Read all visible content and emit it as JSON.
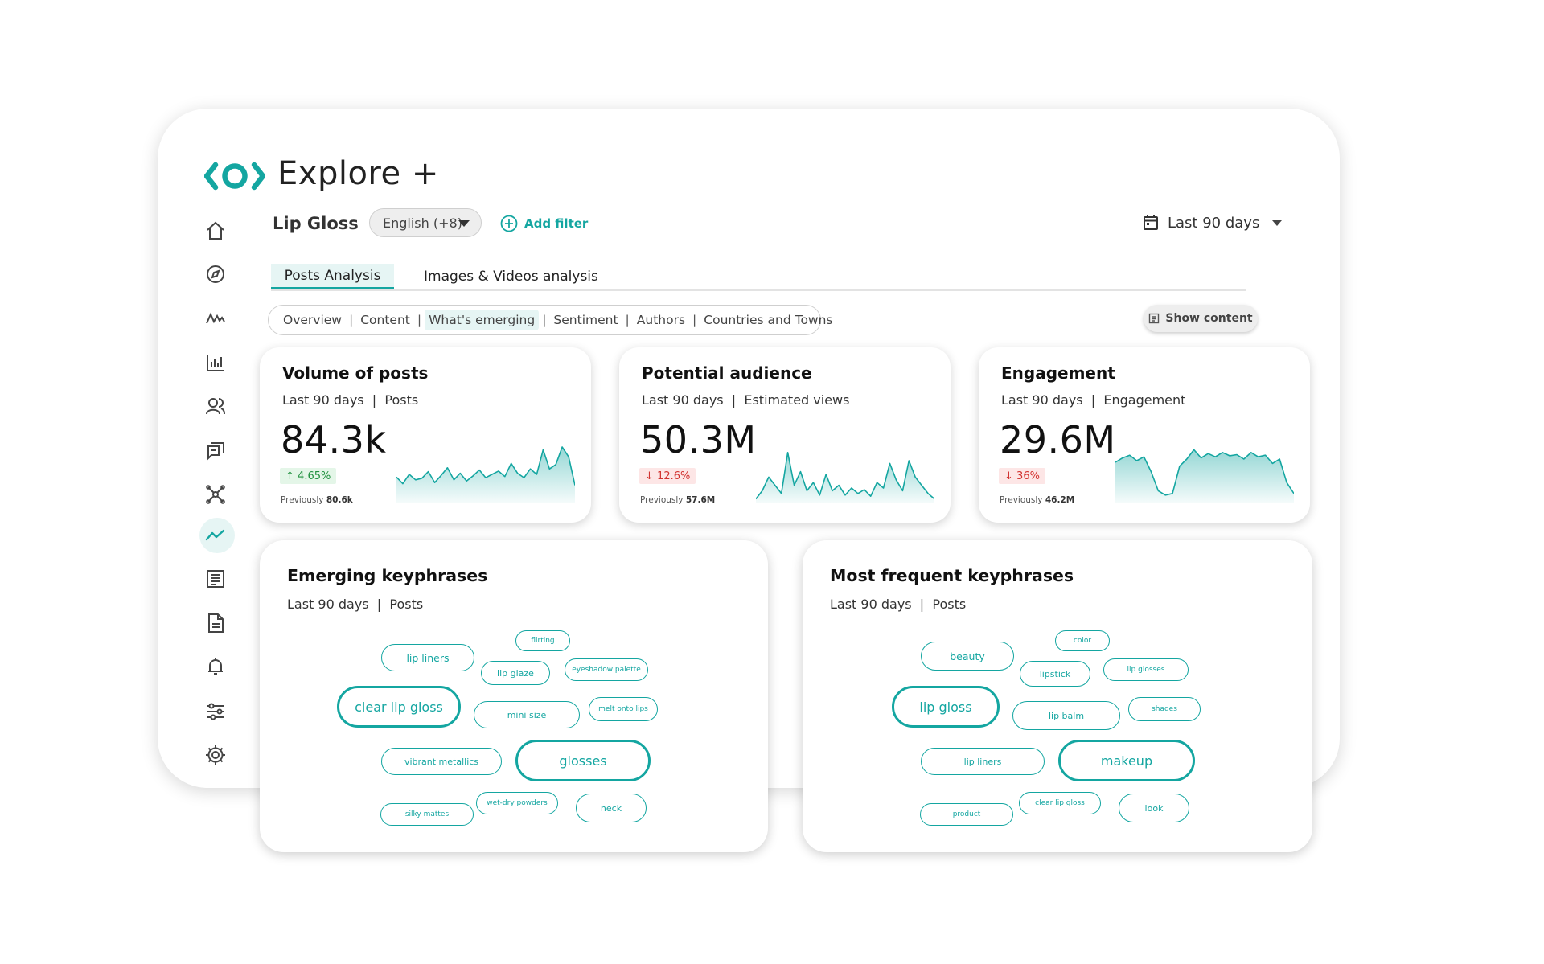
{
  "app": {
    "title": "Explore +",
    "accent": "#14a6a1"
  },
  "sidebar": {
    "items": [
      {
        "icon": "home-icon"
      },
      {
        "icon": "compass-icon"
      },
      {
        "icon": "trends-icon"
      },
      {
        "icon": "bar-chart-icon"
      },
      {
        "icon": "users-icon"
      },
      {
        "icon": "chat-icon"
      },
      {
        "icon": "network-icon"
      },
      {
        "icon": "line-chart-icon",
        "active": true
      },
      {
        "icon": "report-icon"
      },
      {
        "icon": "document-icon"
      },
      {
        "icon": "bell-icon"
      },
      {
        "icon": "sliders-icon"
      },
      {
        "icon": "settings-icon"
      }
    ]
  },
  "filters": {
    "query": "Lip Gloss",
    "language": "English (+8)",
    "add_filter": "Add filter",
    "date_range": "Last 90 days"
  },
  "tabs": [
    {
      "label": "Posts Analysis",
      "active": true
    },
    {
      "label": "Images & Videos analysis",
      "active": false
    }
  ],
  "subnav": {
    "items": [
      "Overview",
      "Content",
      "What's emerging",
      "Sentiment",
      "Authors",
      "Countries and Towns"
    ],
    "active": "What's emerging",
    "separator": "|"
  },
  "show_content": "Show content",
  "metrics": [
    {
      "title": "Volume of posts",
      "period": "Last 90 days",
      "measure": "Posts",
      "value": "84.3k",
      "change": "4.65%",
      "change_arrow": "↑",
      "direction": "up",
      "previous_label": "Previously",
      "previous": "80.6k",
      "spark": [
        0.45,
        0.33,
        0.5,
        0.4,
        0.43,
        0.55,
        0.35,
        0.48,
        0.62,
        0.4,
        0.52,
        0.38,
        0.47,
        0.58,
        0.44,
        0.5,
        0.56,
        0.46,
        0.7,
        0.52,
        0.44,
        0.6,
        0.5,
        0.95,
        0.6,
        0.68,
        1.0,
        0.82,
        0.3
      ]
    },
    {
      "title": "Potential audience",
      "period": "Last 90 days",
      "measure": "Estimated views",
      "value": "50.3M",
      "change": "12.6%",
      "change_arrow": "↓",
      "direction": "down",
      "previous_label": "Previously",
      "previous": "57.6M",
      "spark": [
        0.05,
        0.2,
        0.45,
        0.3,
        0.15,
        0.9,
        0.3,
        0.55,
        0.2,
        0.35,
        0.12,
        0.5,
        0.2,
        0.3,
        0.12,
        0.25,
        0.15,
        0.22,
        0.1,
        0.35,
        0.25,
        0.7,
        0.4,
        0.2,
        0.75,
        0.45,
        0.3,
        0.15,
        0.05
      ]
    },
    {
      "title": "Engagement",
      "period": "Last 90 days",
      "measure": "Engagement",
      "value": "29.6M",
      "change": "36%",
      "change_arrow": "↓",
      "direction": "down",
      "previous_label": "Previously",
      "previous": "46.2M",
      "spark": [
        0.72,
        0.8,
        0.85,
        0.75,
        0.82,
        0.55,
        0.2,
        0.12,
        0.15,
        0.65,
        0.78,
        0.95,
        0.8,
        0.88,
        0.82,
        0.9,
        0.84,
        0.86,
        0.78,
        0.9,
        0.82,
        0.85,
        0.7,
        0.78,
        0.35,
        0.15
      ]
    }
  ],
  "keyphrases": {
    "emerging": {
      "title": "Emerging keyphrases",
      "period": "Last 90 days",
      "measure": "Posts",
      "bubbles": [
        "lip liners",
        "flirting",
        "lip glaze",
        "eyeshadow palette",
        "clear lip gloss",
        "mini size",
        "melt onto lips",
        "vibrant metallics",
        "glosses",
        "wet-dry powders",
        "silky mattes",
        "neck"
      ]
    },
    "frequent": {
      "title": "Most frequent keyphrases",
      "period": "Last 90 days",
      "measure": "Posts",
      "bubbles": [
        "beauty",
        "color",
        "lipstick",
        "lip glosses",
        "lip gloss",
        "lip balm",
        "shades",
        "lip liners",
        "makeup",
        "clear lip gloss",
        "product",
        "look"
      ]
    }
  }
}
